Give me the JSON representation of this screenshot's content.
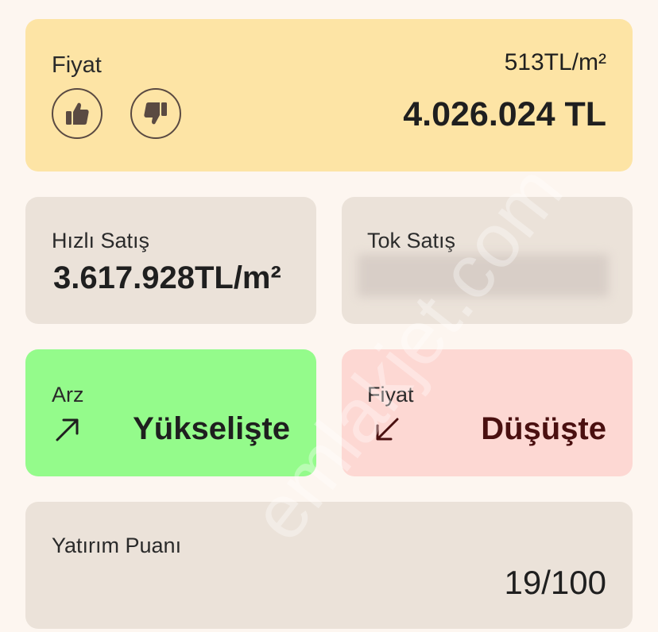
{
  "price": {
    "label": "Fiyat",
    "per_m2": "513TL/m²",
    "total": "4.026.024 TL",
    "like_icon": "thumbs-up-icon",
    "dislike_icon": "thumbs-down-icon"
  },
  "quick_sale": {
    "label": "Hızlı Satış",
    "value": "3.617.928TL/m²"
  },
  "bulk_sale": {
    "label": "Tok Satış"
  },
  "supply": {
    "label": "Arz",
    "status": "Yükselişte",
    "icon": "arrow-up-right-icon",
    "color": "#94fb8b"
  },
  "price_trend": {
    "label": "Fiyat",
    "status": "Düşüşte",
    "icon": "arrow-down-left-icon",
    "color": "#fdd8d3"
  },
  "investment": {
    "label": "Yatırım Puanı",
    "score": "19/100"
  },
  "watermark": "emlakjet.com"
}
